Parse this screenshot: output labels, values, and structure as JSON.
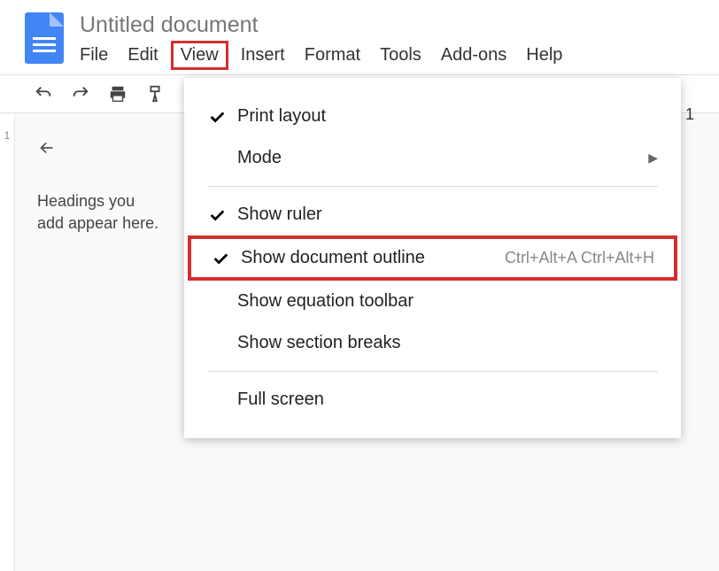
{
  "title": "Untitled document",
  "menubar": [
    "File",
    "Edit",
    "View",
    "Insert",
    "Format",
    "Tools",
    "Add-ons",
    "Help"
  ],
  "activeMenuIndex": 2,
  "toolbar": {
    "right_value": "1"
  },
  "outline": {
    "placeholder": "Headings you add appear here."
  },
  "viewMenu": {
    "items": [
      {
        "label": "Print layout",
        "checked": true
      },
      {
        "label": "Mode",
        "submenu": true
      }
    ],
    "items2": [
      {
        "label": "Show ruler",
        "checked": true
      },
      {
        "label": "Show document outline",
        "checked": true,
        "shortcut": "Ctrl+Alt+A Ctrl+Alt+H",
        "highlight": true
      },
      {
        "label": "Show equation toolbar"
      },
      {
        "label": "Show section breaks"
      }
    ],
    "items3": [
      {
        "label": "Full screen"
      }
    ]
  },
  "ruler": [
    "1"
  ]
}
